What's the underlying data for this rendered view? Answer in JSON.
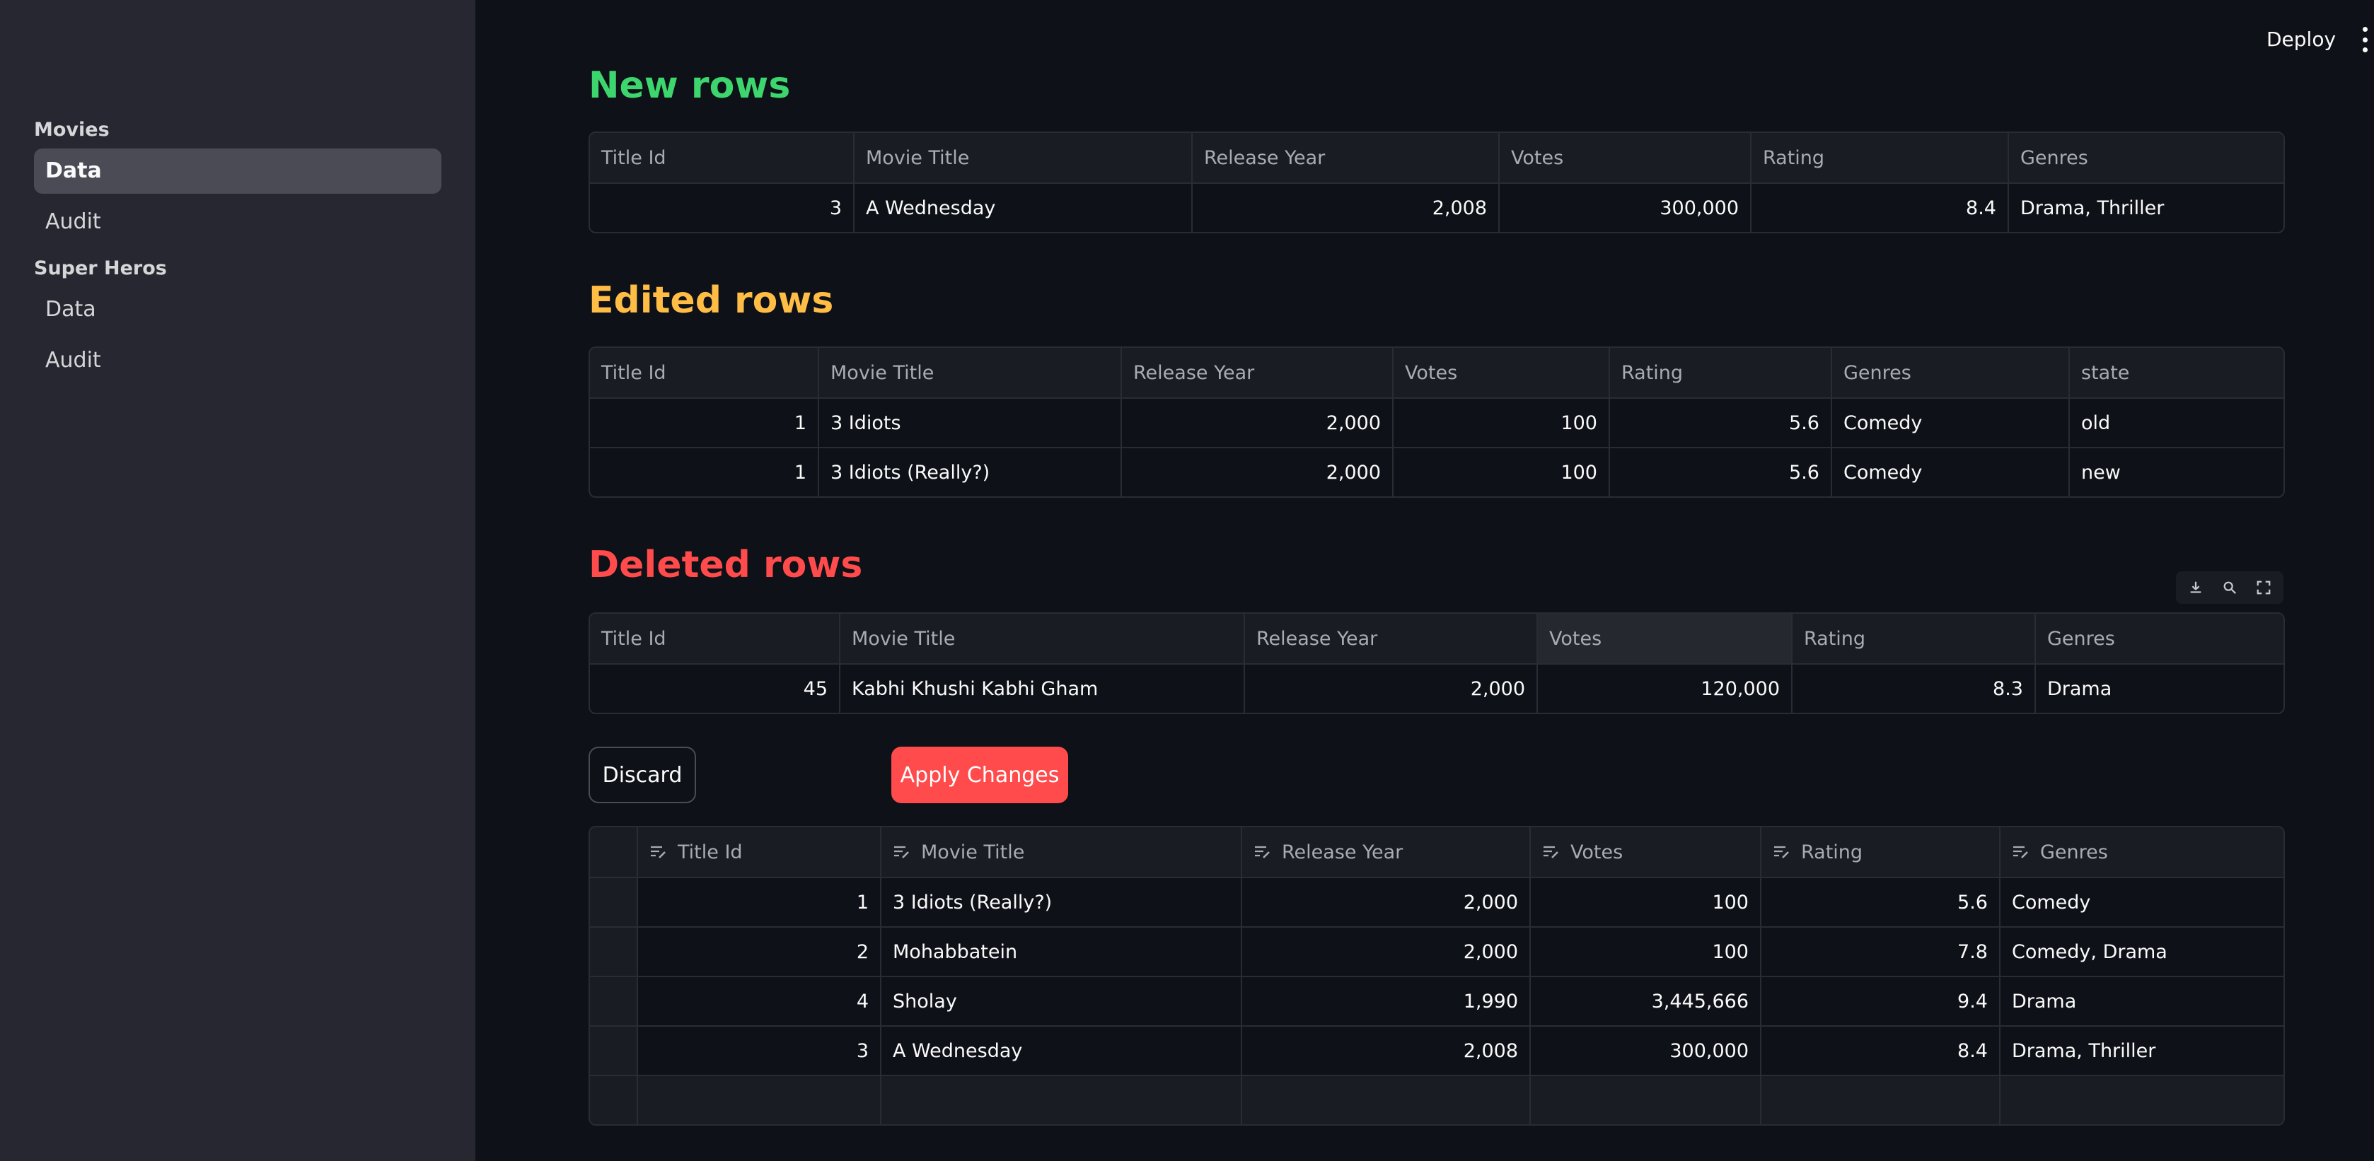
{
  "header": {
    "deploy_label": "Deploy"
  },
  "sidebar": {
    "sections": [
      {
        "label": "Movies",
        "items": [
          {
            "label": "Data",
            "active": true
          },
          {
            "label": "Audit",
            "active": false
          }
        ]
      },
      {
        "label": "Super Heros",
        "items": [
          {
            "label": "Data",
            "active": false
          },
          {
            "label": "Audit",
            "active": false
          }
        ]
      }
    ]
  },
  "new_rows": {
    "title": "New rows",
    "title_color": "#3dd56d",
    "columns": [
      "Title Id",
      "Movie Title",
      "Release Year",
      "Votes",
      "Rating",
      "Genres"
    ],
    "rows": [
      [
        "3",
        "A Wednesday",
        "2,008",
        "300,000",
        "8.4",
        "Drama, Thriller"
      ]
    ]
  },
  "edited_rows": {
    "title": "Edited rows",
    "title_color": "#ffbd45",
    "columns": [
      "Title Id",
      "Movie Title",
      "Release Year",
      "Votes",
      "Rating",
      "Genres",
      "state"
    ],
    "rows": [
      [
        "1",
        "3 Idiots",
        "2,000",
        "100",
        "5.6",
        "Comedy",
        "old"
      ],
      [
        "1",
        "3 Idiots (Really?)",
        "2,000",
        "100",
        "5.6",
        "Comedy",
        "new"
      ]
    ]
  },
  "deleted_rows": {
    "title": "Deleted rows",
    "title_color": "#ff4b4b",
    "columns": [
      "Title Id",
      "Movie Title",
      "Release Year",
      "Votes",
      "Rating",
      "Genres"
    ],
    "rows": [
      [
        "45",
        "Kabhi Khushi Kabhi Gham",
        "2,000",
        "120,000",
        "8.3",
        "Drama"
      ]
    ]
  },
  "actions": {
    "discard_label": "Discard",
    "apply_label": "Apply Changes",
    "apply_color": "#ff4b4b"
  },
  "editor": {
    "columns": [
      "Title Id",
      "Movie Title",
      "Release Year",
      "Votes",
      "Rating",
      "Genres"
    ],
    "rows": [
      [
        "1",
        "3 Idiots (Really?)",
        "2,000",
        "100",
        "5.6",
        "Comedy"
      ],
      [
        "2",
        "Mohabbatein",
        "2,000",
        "100",
        "7.8",
        "Comedy, Drama"
      ],
      [
        "4",
        "Sholay",
        "1,990",
        "3,445,666",
        "9.4",
        "Drama"
      ],
      [
        "3",
        "A Wednesday",
        "2,008",
        "300,000",
        "8.4",
        "Drama, Thriller"
      ]
    ]
  }
}
